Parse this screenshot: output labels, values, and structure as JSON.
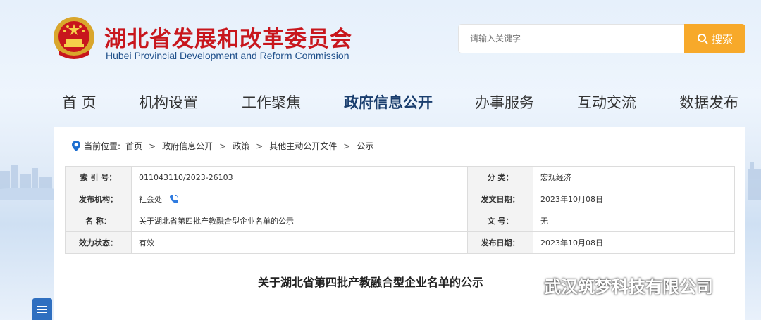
{
  "header": {
    "title_cn": "湖北省发展和改革委员会",
    "title_en": "Hubei Provincial Development and Reform Commission",
    "search_placeholder": "请输入关键字",
    "search_label": "搜索"
  },
  "nav": [
    {
      "label": "首 页"
    },
    {
      "label": "机构设置"
    },
    {
      "label": "工作聚焦"
    },
    {
      "label": "政府信息公开"
    },
    {
      "label": "办事服务"
    },
    {
      "label": "互动交流"
    },
    {
      "label": "数据发布"
    }
  ],
  "breadcrumb": {
    "prefix": "当前位置:",
    "items": [
      "首页",
      "政府信息公开",
      "政策",
      "其他主动公开文件",
      "公示"
    ],
    "separator": ">"
  },
  "meta": {
    "index_key": "索 引 号：",
    "index_val": "011043110/2023-26103",
    "category_key": "分      类：",
    "category_val": "宏观经济",
    "publisher_key": "发布机构：",
    "publisher_val": "社会处",
    "doc_date_key": "发文日期：",
    "doc_date_val": "2023年10月08日",
    "name_key": "名      称：",
    "name_val": "关于湖北省第四批产教融合型企业名单的公示",
    "doc_no_key": "文      号：",
    "doc_no_val": "无",
    "status_key": "效力状态：",
    "status_val": "有效",
    "pub_date_key": "发布日期：",
    "pub_date_val": "2023年10月08日"
  },
  "doc_title": "关于湖北省第四批产教融合型企业名单的公示",
  "watermark": "武汉筑梦科技有限公司",
  "colors": {
    "brand_red": "#c8161d",
    "accent_orange": "#f7a92a",
    "nav_active": "#1a3e6e"
  }
}
